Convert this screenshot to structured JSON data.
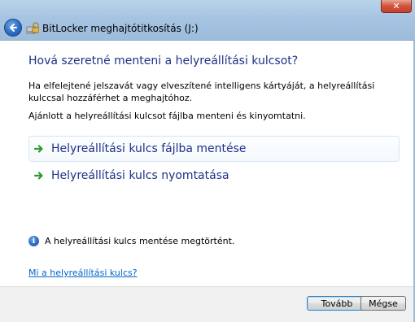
{
  "window": {
    "title": "BitLocker meghajtótitkosítás (J:)",
    "close_glyph": "✕"
  },
  "main": {
    "heading": "Hová szeretné menteni a helyreállítási kulcsot?",
    "description": "Ha elfelejtené jelszavát vagy elveszítené intelligens kártyáját, a helyreállítási kulccsal hozzáférhet a meghajtóhoz.",
    "recommendation": "Ajánlott a helyreállítási kulcsot fájlba menteni és kinyomtatni.",
    "options": [
      {
        "label": "Helyreállítási kulcs fájlba mentése",
        "icon": "green-arrow-icon"
      },
      {
        "label": "Helyreállítási kulcs nyomtatása",
        "icon": "green-arrow-icon"
      }
    ],
    "status_message": "A helyreállítási kulcs mentése megtörtént.",
    "help_link": "Mi a helyreállítási kulcs?"
  },
  "footer": {
    "next_label": "Tovább",
    "cancel_label": "Mégse"
  },
  "colors": {
    "heading": "#1e3287",
    "link": "#0066cc",
    "arrow": "#2e9a2e"
  }
}
